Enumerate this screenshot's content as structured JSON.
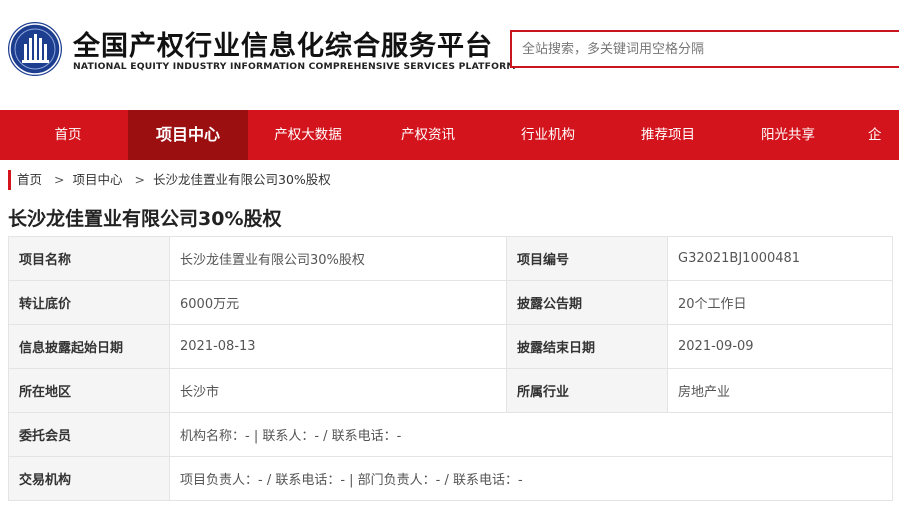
{
  "header": {
    "logo_icon": "emblem-icon",
    "title": "全国产权行业信息化综合服务平台",
    "subtitle": "NATIONAL EQUITY INDUSTRY INFORMATION COMPREHENSIVE SERVICES PLATFORM",
    "search_placeholder": "全站搜索，多关键词用空格分隔"
  },
  "nav": {
    "items": [
      {
        "label": "首页"
      },
      {
        "label": "项目中心"
      },
      {
        "label": "产权大数据"
      },
      {
        "label": "产权资讯"
      },
      {
        "label": "行业机构"
      },
      {
        "label": "推荐项目"
      },
      {
        "label": "阳光共享"
      },
      {
        "label": "企"
      }
    ],
    "active_index": 1
  },
  "breadcrumb": {
    "items": [
      "首页",
      "项目中心",
      "长沙龙佳置业有限公司30%股权"
    ],
    "separator": ">"
  },
  "page_title": "长沙龙佳置业有限公司30%股权",
  "details": {
    "rows": [
      {
        "l1": "项目名称",
        "v1": "长沙龙佳置业有限公司30%股权",
        "l2": "项目编号",
        "v2": "G32021BJ1000481"
      },
      {
        "l1": "转让底价",
        "v1": "6000万元",
        "l2": "披露公告期",
        "v2": "20个工作日"
      },
      {
        "l1": "信息披露起始日期",
        "v1": "2021-08-13",
        "l2": "披露结束日期",
        "v2": "2021-09-09"
      },
      {
        "l1": "所在地区",
        "v1": "长沙市",
        "l2": "所属行业",
        "v2": "房地产业"
      }
    ],
    "wide_rows": [
      {
        "label": "委托会员",
        "value": "机构名称：- | 联系人：- / 联系电话：-"
      },
      {
        "label": "交易机构",
        "value": "项目负责人：- / 联系电话：- | 部门负责人：- / 联系电话：-"
      }
    ]
  },
  "colors": {
    "brand_red": "#d4141c",
    "active_red": "#9c0f11",
    "logo_blue": "#1d3d8f"
  }
}
